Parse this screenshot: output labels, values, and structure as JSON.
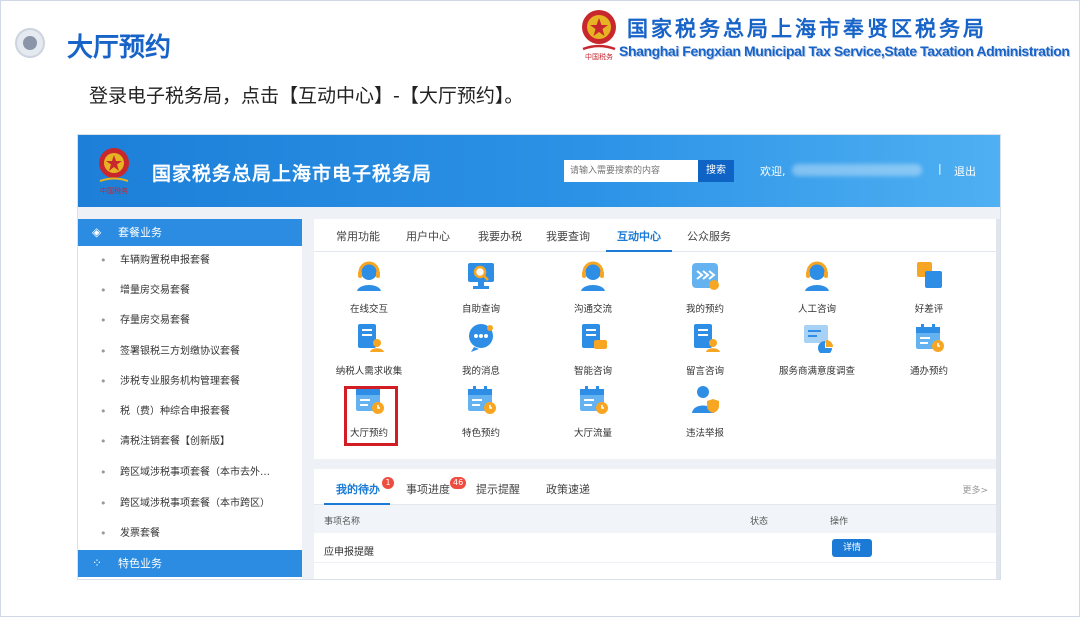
{
  "slide": {
    "title": "大厅预约",
    "org_cn": "国家税务总局上海市奉贤区税务局",
    "org_en": "Shanghai Fengxian Municipal Tax Service,State Taxation Administration",
    "instruction": "登录电子税务局，点击【互动中心】-【大厅预约】。"
  },
  "portal": {
    "title": "国家税务总局上海市电子税务局",
    "search_placeholder": "请输入需要搜索的内容",
    "search_button": "搜索",
    "welcome": "欢迎,",
    "separator": "|",
    "logout": "退出"
  },
  "sidebar": {
    "section1": "套餐业务",
    "items": [
      "车辆购置税申报套餐",
      "增量房交易套餐",
      "存量房交易套餐",
      "签署银税三方划缴协议套餐",
      "涉税专业服务机构管理套餐",
      "税（费）种综合申报套餐",
      "清税注销套餐【创新版】",
      "跨区域涉税事项套餐（本市去外…",
      "跨区域涉税事项套餐（本市跨区）",
      "发票套餐"
    ],
    "section2": "特色业务"
  },
  "tabs": [
    "常用功能",
    "用户中心",
    "我要办税",
    "我要查询",
    "互动中心",
    "公众服务"
  ],
  "active_tab": "互动中心",
  "functions": [
    {
      "label": "在线交互",
      "icon": "headset-person-icon"
    },
    {
      "label": "自助查询",
      "icon": "monitor-search-icon"
    },
    {
      "label": "沟通交流",
      "icon": "headset-person-icon"
    },
    {
      "label": "我的预约",
      "icon": "appointment-arrow-icon"
    },
    {
      "label": "人工咨询",
      "icon": "headset-person-icon"
    },
    {
      "label": "好差评",
      "icon": "rating-squares-icon"
    },
    {
      "label": "纳税人需求收集",
      "icon": "document-person-icon"
    },
    {
      "label": "我的消息",
      "icon": "chat-bubble-icon"
    },
    {
      "label": "智能咨询",
      "icon": "document-chat-icon"
    },
    {
      "label": "留言咨询",
      "icon": "document-person-icon"
    },
    {
      "label": "服务商满意度调查",
      "icon": "survey-chart-icon"
    },
    {
      "label": "通办预约",
      "icon": "calendar-clock-icon"
    },
    {
      "label": "大厅预约",
      "icon": "calendar-clock-icon"
    },
    {
      "label": "特色预约",
      "icon": "calendar-clock-icon"
    },
    {
      "label": "大厅流量",
      "icon": "calendar-clock-icon"
    },
    {
      "label": "违法举报",
      "icon": "person-shield-icon"
    }
  ],
  "todo": {
    "tabs": [
      "我的待办",
      "事项进度",
      "提示提醒",
      "政策速递"
    ],
    "badge_todo": "1",
    "badge_progress": "46",
    "more": "更多>",
    "headers": {
      "name": "事项名称",
      "status": "状态",
      "action": "操作"
    },
    "rows": [
      {
        "name": "应申报提醒",
        "status": "",
        "action": "详情"
      }
    ]
  },
  "colors": {
    "brand_blue": "#1863c8",
    "topbar": "#2b8ce2",
    "highlight": "#d21d24",
    "icon_blue": "#2e8ee6",
    "icon_orange": "#f6a623"
  }
}
